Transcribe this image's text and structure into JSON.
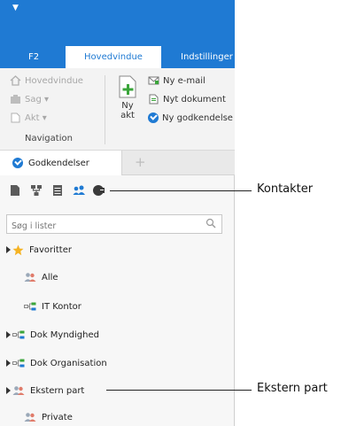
{
  "ribbon": {
    "tabs": [
      {
        "label": "F2"
      },
      {
        "label": "Hovedvindue"
      },
      {
        "label": "Indstillinger"
      }
    ],
    "navigation_group": {
      "items": [
        {
          "label": "Hovedvindue"
        },
        {
          "label": "Sag ▾"
        },
        {
          "label": "Akt ▾"
        }
      ],
      "group_label": "Navigation"
    },
    "new_group": {
      "new_act_line1": "Ny",
      "new_act_line2": "akt",
      "items": [
        {
          "label": "Ny e-mail"
        },
        {
          "label": "Nyt dokument"
        },
        {
          "label": "Ny godkendelse"
        }
      ]
    }
  },
  "doc_tab": {
    "label": "Godkendelser",
    "add_label": "+"
  },
  "panel": {
    "search_placeholder": "Søg i lister",
    "items": [
      {
        "label": "Favoritter"
      },
      {
        "label": "Alle"
      },
      {
        "label": "IT Kontor"
      },
      {
        "label": "Dok Myndighed"
      },
      {
        "label": "Dok Organisation"
      },
      {
        "label": "Ekstern part"
      },
      {
        "label": "Private"
      }
    ]
  },
  "callouts": [
    {
      "label": "Kontakter"
    },
    {
      "label": "Ekstern part"
    }
  ],
  "colors": {
    "accent": "#1f7ad3",
    "star": "#f5b323"
  }
}
